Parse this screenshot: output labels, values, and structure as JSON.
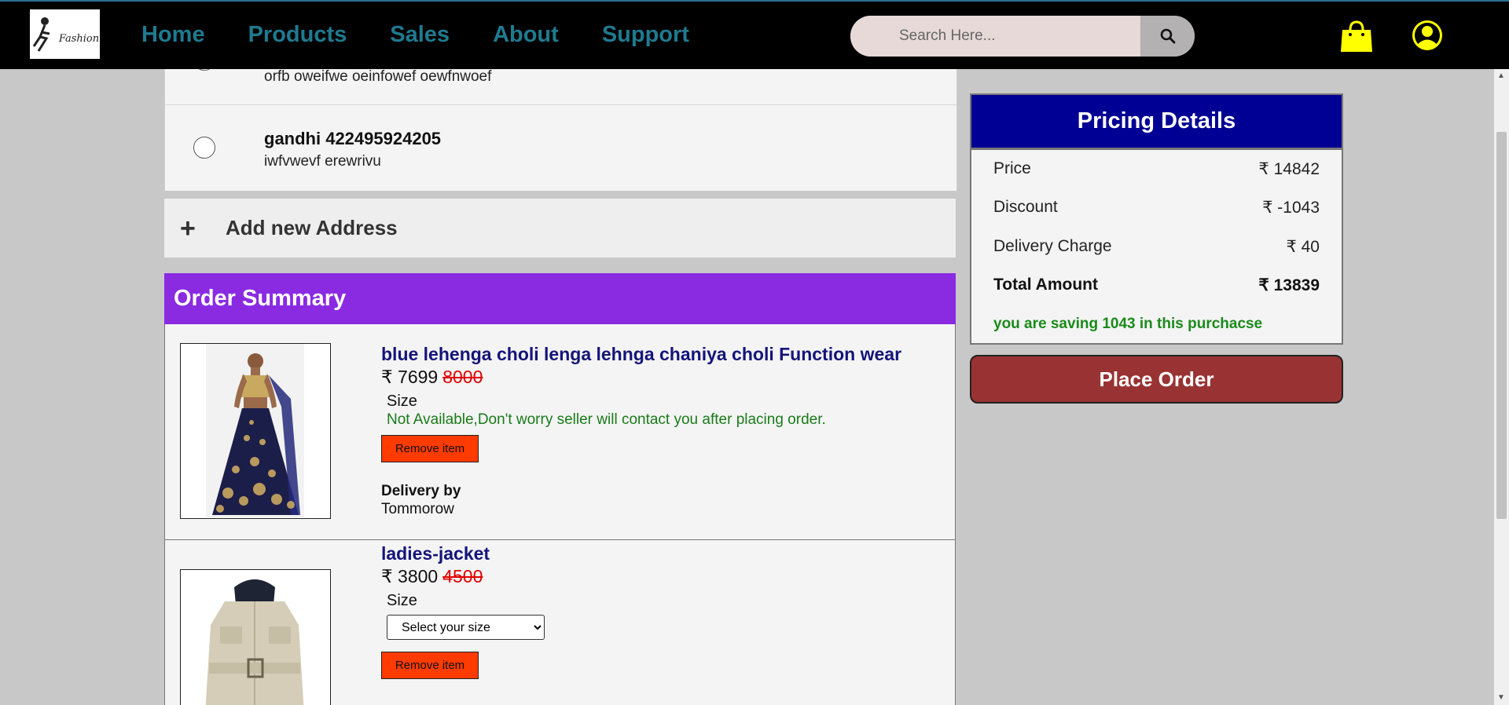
{
  "nav": {
    "logo_text": "Fashion",
    "links": [
      "Home",
      "Products",
      "Sales",
      "About",
      "Support"
    ],
    "search_placeholder": "Search Here...",
    "link_color": "#1f7a8f",
    "icon_color": "#ffff00"
  },
  "addresses": [
    {
      "name": "",
      "line": "orfb oweifwe oeinfowef oewfnwoef"
    },
    {
      "name": "gandhi 422495924205",
      "line": "iwfvwevf erewrivu"
    }
  ],
  "add_address": {
    "icon": "+",
    "label": "Add new Address"
  },
  "order_summary": {
    "title": "Order Summary",
    "items": [
      {
        "title": "blue lehenga choli lenga lehnga chaniya choli Function wear",
        "price": "₹ 7699",
        "mrp": "8000",
        "size_label": "Size",
        "size_note": "Not Available,Don't worry seller will contact you after placing order.",
        "remove_label": "Remove item",
        "delivery_label": "Delivery by",
        "delivery_value": "Tommorow"
      },
      {
        "title": "ladies-jacket",
        "price": "₹ 3800",
        "mrp": "4500",
        "size_label": "Size",
        "size_select": "Select your size",
        "remove_label": "Remove item"
      }
    ]
  },
  "pricing": {
    "title": "Pricing Details",
    "rows": [
      {
        "label": "Price",
        "value": "₹ 14842"
      },
      {
        "label": "Discount",
        "value": "₹ -1043"
      },
      {
        "label": "Delivery Charge",
        "value": "₹ 40"
      },
      {
        "label": "Total Amount",
        "value": "₹ 13839"
      }
    ],
    "saving_note": "you are saving 1043 in this purchacse",
    "header_color": "#000094"
  },
  "place_order": {
    "label": "Place Order",
    "color": "#993333"
  },
  "colors": {
    "summary_header": "#8a2be2",
    "remove_button": "#ff3b00",
    "page_bg": "#c9c8c9"
  }
}
